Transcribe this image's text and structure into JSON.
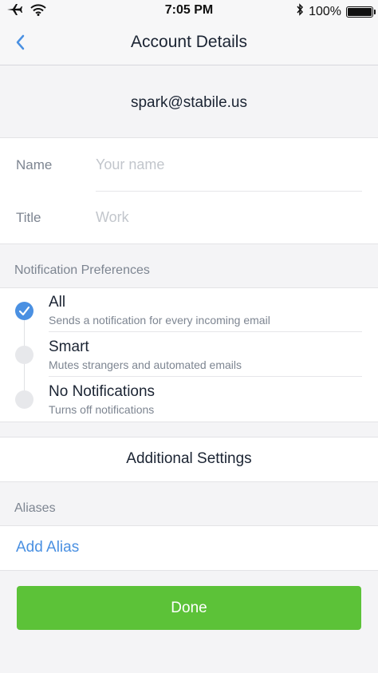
{
  "status_bar": {
    "time": "7:05 PM",
    "battery": "100%",
    "icons": [
      "airplane-icon",
      "wifi-icon",
      "bluetooth-icon",
      "battery-icon"
    ]
  },
  "header": {
    "title": "Account Details",
    "back_icon": "chevron-left-icon"
  },
  "account": {
    "email": "spark@stabile.us"
  },
  "fields": [
    {
      "label": "Name",
      "value": "",
      "placeholder": "Your name"
    },
    {
      "label": "Title",
      "value": "",
      "placeholder": "Work"
    }
  ],
  "notifications": {
    "section_label": "Notification Preferences",
    "selected": "All",
    "options": [
      {
        "name": "All",
        "description": "Sends a notification for every incoming email",
        "checked": true
      },
      {
        "name": "Smart",
        "description": "Mutes strangers and automated emails",
        "checked": false
      },
      {
        "name": "No Notifications",
        "description": "Turns off notifications",
        "checked": false
      }
    ]
  },
  "additional_settings": {
    "label": "Additional Settings"
  },
  "aliases": {
    "section_label": "Aliases",
    "add_label": "Add Alias"
  },
  "done_button": {
    "label": "Done"
  },
  "colors": {
    "accent": "#4a90e2",
    "done": "#5cc238",
    "background": "#f4f4f6",
    "text": "#1b2433",
    "muted": "#7d8591"
  }
}
